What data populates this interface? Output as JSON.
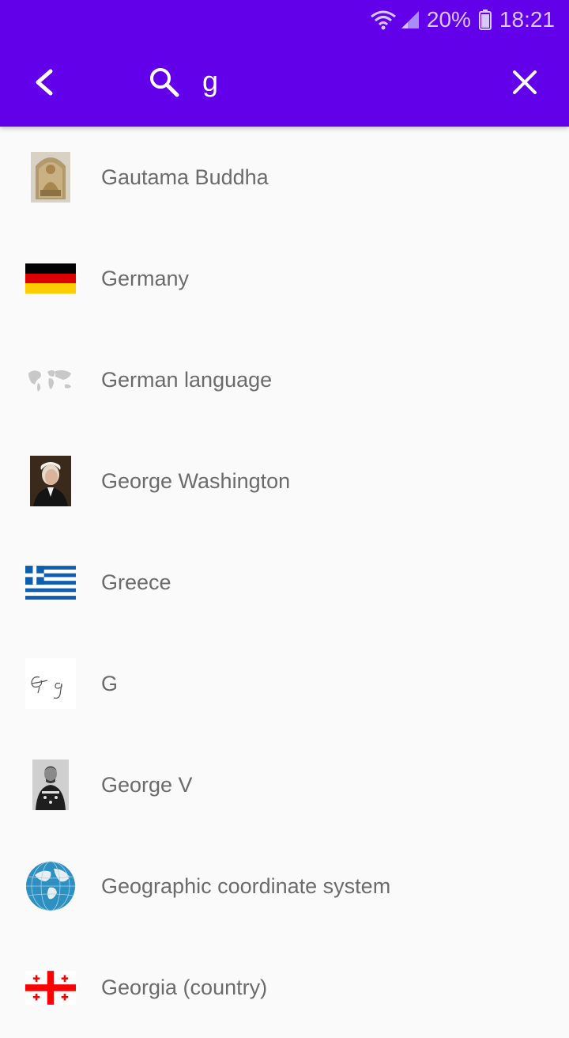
{
  "status_bar": {
    "battery": "20%",
    "time": "18:21",
    "wifi_icon": "wifi-icon",
    "signal_icon": "signal-icon",
    "battery_icon": "battery-icon"
  },
  "toolbar": {
    "back_icon": "chevron-left-icon",
    "search_icon": "search-icon",
    "query": "g",
    "clear_icon": "close-icon",
    "background": "#6200ea"
  },
  "results": [
    {
      "title": "Gautama Buddha",
      "thumb": "buddha-statue-thumbnail"
    },
    {
      "title": "Germany",
      "thumb": "germany-flag"
    },
    {
      "title": "German language",
      "thumb": "world-map-thumbnail"
    },
    {
      "title": "George Washington",
      "thumb": "portrait-thumbnail"
    },
    {
      "title": "Greece",
      "thumb": "greece-flag"
    },
    {
      "title": "G",
      "thumb": "cursive-g-thumbnail"
    },
    {
      "title": "George V",
      "thumb": "portrait-thumbnail"
    },
    {
      "title": "Geographic coordinate system",
      "thumb": "globe-thumbnail"
    },
    {
      "title": "Georgia (country)",
      "thumb": "georgia-flag"
    }
  ]
}
